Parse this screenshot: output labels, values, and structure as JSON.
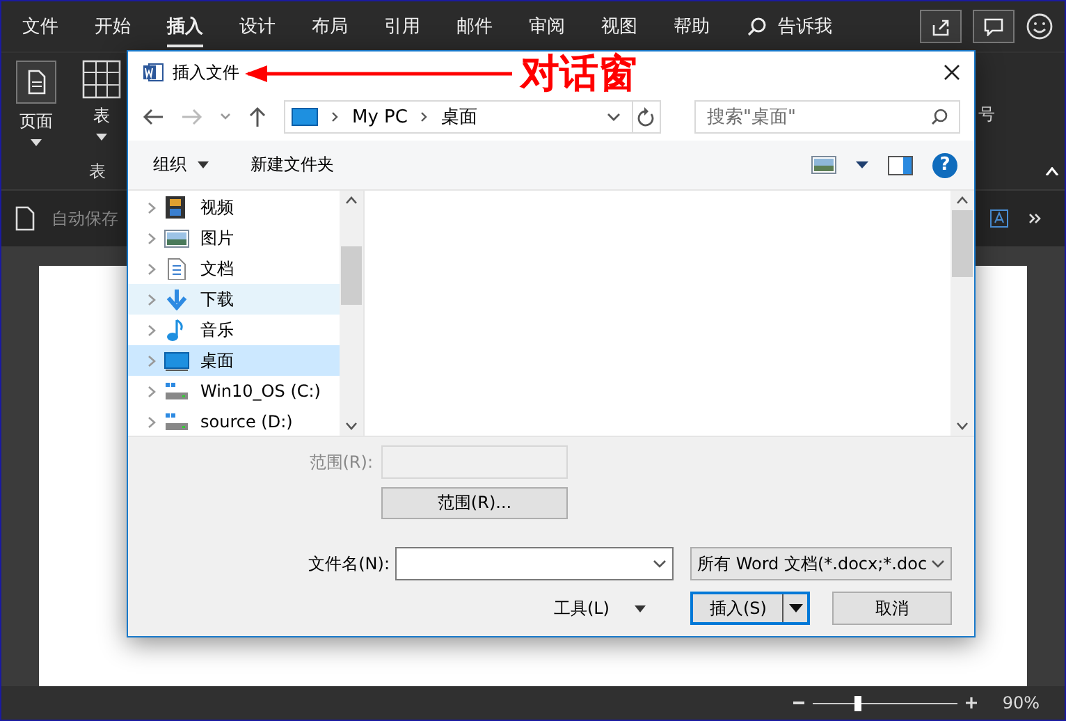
{
  "app": {
    "menu_tabs": [
      {
        "label": "文件",
        "selected": false
      },
      {
        "label": "开始",
        "selected": false
      },
      {
        "label": "插入",
        "selected": true
      },
      {
        "label": "设计",
        "selected": false
      },
      {
        "label": "布局",
        "selected": false
      },
      {
        "label": "引用",
        "selected": false
      },
      {
        "label": "邮件",
        "selected": false
      },
      {
        "label": "审阅",
        "selected": false
      },
      {
        "label": "视图",
        "selected": false
      },
      {
        "label": "帮助",
        "selected": false
      }
    ],
    "tell_me": "告诉我",
    "ribbon": {
      "buttons": [
        {
          "label": "页面",
          "kind": "page"
        },
        {
          "label": "表",
          "kind": "table"
        }
      ],
      "group_label": "表",
      "right_label": "号"
    },
    "quick_access": {
      "autosave": "自动保存"
    },
    "status_bar": {
      "zoom": {
        "level": 0.3,
        "reading": "90%"
      }
    }
  },
  "dialog": {
    "title": "插入文件",
    "address": {
      "path": [
        "My PC",
        "桌面"
      ]
    },
    "search": {
      "placeholder": "搜索\"桌面\""
    },
    "toolbar": {
      "organize": "组织",
      "new_folder": "新建文件夹",
      "help": "?"
    },
    "nav_items": [
      {
        "label": "视频",
        "kind": "video",
        "selected": false,
        "hovered": false
      },
      {
        "label": "图片",
        "kind": "picture",
        "selected": false,
        "hovered": false
      },
      {
        "label": "文档",
        "kind": "document",
        "selected": false,
        "hovered": false
      },
      {
        "label": "下载",
        "kind": "download",
        "selected": false,
        "hovered": true
      },
      {
        "label": "音乐",
        "kind": "music",
        "selected": false,
        "hovered": false
      },
      {
        "label": "桌面",
        "kind": "desktop",
        "selected": true,
        "hovered": false
      },
      {
        "label": "Win10_OS (C:)",
        "kind": "drive",
        "selected": false,
        "hovered": false
      },
      {
        "label": "source (D:)",
        "kind": "drive",
        "selected": false,
        "hovered": false
      }
    ],
    "range": {
      "label": "范围(R):",
      "button": "范围(R)..."
    },
    "file_name": {
      "label": "文件名(N):"
    },
    "file_type": {
      "value": "所有 Word 文档(*.docx;*.doc"
    },
    "buttons": {
      "tools": "工具(L)",
      "insert": "插入(S)",
      "cancel": "取消"
    }
  },
  "annotation": {
    "text": "对话窗"
  }
}
